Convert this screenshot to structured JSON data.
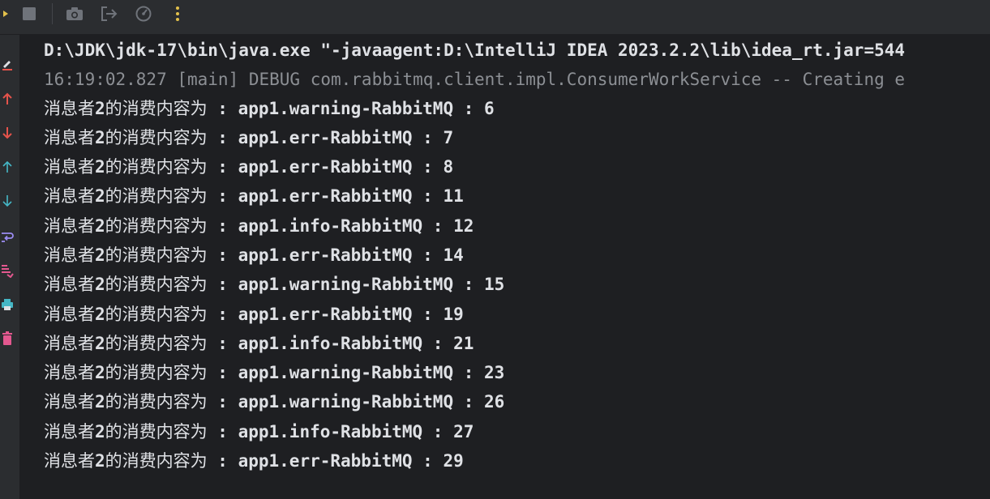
{
  "colors": {
    "background": "#1e1f22",
    "toolbar": "#2b2d30",
    "text": "#dfe1e5",
    "debug_text": "#8c8f94",
    "accent_yellow": "#e2c04b",
    "accent_red": "#e5534b",
    "accent_teal": "#45b7c6",
    "accent_purple": "#9b8cf2",
    "accent_pink": "#e3588f"
  },
  "toolbar": {
    "icons": [
      "run-icon",
      "stop-icon",
      "camera-icon",
      "exit-icon",
      "dashboard-icon",
      "more-icon"
    ]
  },
  "gutter": {
    "icons": [
      "edit-icon",
      "up-arrow-icon",
      "down-arrow-icon",
      "up-arrow-light-icon",
      "down-arrow-light-icon",
      "soft-wrap-icon",
      "scroll-to-end-icon",
      "print-icon",
      "trash-icon"
    ]
  },
  "console": {
    "command_line": "D:\\JDK\\jdk-17\\bin\\java.exe \"-javaagent:D:\\IntelliJ IDEA 2023.2.2\\lib\\idea_rt.jar=544",
    "debug_line": "16:19:02.827 [main] DEBUG com.rabbitmq.client.impl.ConsumerWorkService -- Creating e",
    "lines": [
      {
        "prefix": "消息者",
        "num": "2",
        "suffix": "的消费内容为",
        "message": " : app1.warning-RabbitMQ : 6"
      },
      {
        "prefix": "消息者",
        "num": "2",
        "suffix": "的消费内容为",
        "message": " : app1.err-RabbitMQ : 7"
      },
      {
        "prefix": "消息者",
        "num": "2",
        "suffix": "的消费内容为",
        "message": " : app1.err-RabbitMQ : 8"
      },
      {
        "prefix": "消息者",
        "num": "2",
        "suffix": "的消费内容为",
        "message": " : app1.err-RabbitMQ : 11"
      },
      {
        "prefix": "消息者",
        "num": "2",
        "suffix": "的消费内容为",
        "message": " : app1.info-RabbitMQ : 12"
      },
      {
        "prefix": "消息者",
        "num": "2",
        "suffix": "的消费内容为",
        "message": " : app1.err-RabbitMQ : 14"
      },
      {
        "prefix": "消息者",
        "num": "2",
        "suffix": "的消费内容为",
        "message": " : app1.warning-RabbitMQ : 15"
      },
      {
        "prefix": "消息者",
        "num": "2",
        "suffix": "的消费内容为",
        "message": " : app1.err-RabbitMQ : 19"
      },
      {
        "prefix": "消息者",
        "num": "2",
        "suffix": "的消费内容为",
        "message": " : app1.info-RabbitMQ : 21"
      },
      {
        "prefix": "消息者",
        "num": "2",
        "suffix": "的消费内容为",
        "message": " : app1.warning-RabbitMQ : 23"
      },
      {
        "prefix": "消息者",
        "num": "2",
        "suffix": "的消费内容为",
        "message": " : app1.warning-RabbitMQ : 26"
      },
      {
        "prefix": "消息者",
        "num": "2",
        "suffix": "的消费内容为",
        "message": " : app1.info-RabbitMQ : 27"
      },
      {
        "prefix": "消息者",
        "num": "2",
        "suffix": "的消费内容为",
        "message": " : app1.err-RabbitMQ : 29"
      }
    ]
  }
}
